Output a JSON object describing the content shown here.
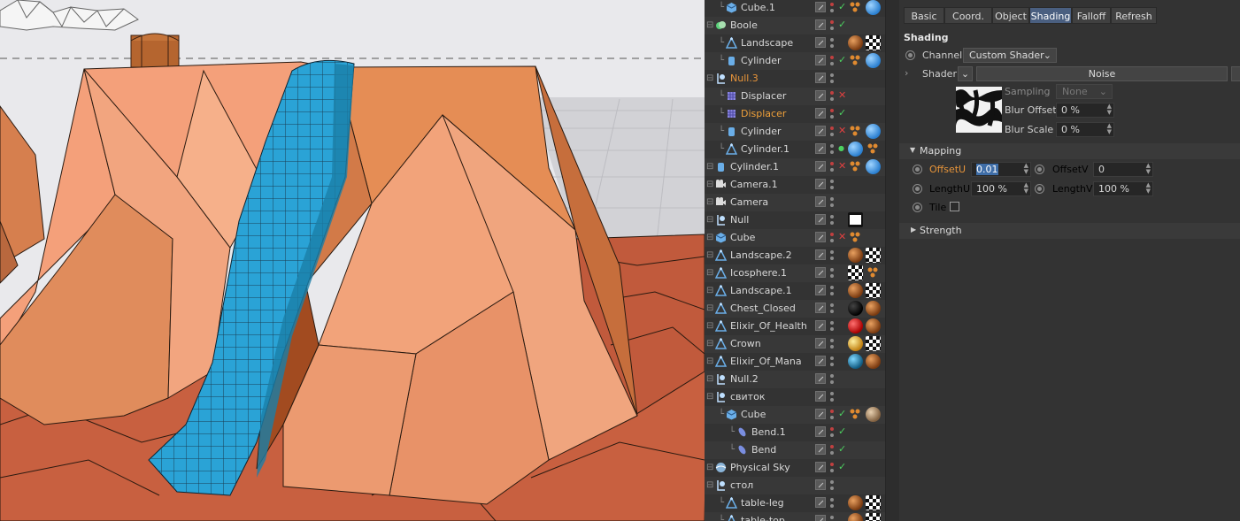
{
  "object_manager": {
    "rows": [
      {
        "name": "Cube.1",
        "icon": "cube-icon",
        "indent": 1,
        "flag": "check",
        "tags": [
          "dots-tag",
          "blue-sphere-tag"
        ],
        "color": "#d8d8d8"
      },
      {
        "name": "Boole",
        "icon": "boole-icon",
        "indent": 0,
        "flag": "check",
        "tags": [],
        "color": "#d8d8d8"
      },
      {
        "name": "Landscape",
        "icon": "landscape-icon",
        "indent": 1,
        "flag": "",
        "tags": [
          "brown-sphere-tag",
          "checker-tag"
        ],
        "color": "#d8d8d8"
      },
      {
        "name": "Cylinder",
        "icon": "cylinder-icon",
        "indent": 1,
        "flag": "check",
        "tags": [
          "dots-tag",
          "blue-sphere-tag"
        ],
        "color": "#d8d8d8"
      },
      {
        "name": "Null.3",
        "icon": "null-icon",
        "indent": 0,
        "flag": "",
        "tags": [],
        "color": "#e8953a"
      },
      {
        "name": "Displacer",
        "icon": "displacer-icon",
        "indent": 1,
        "flag": "cross",
        "tags": [],
        "color": "#d8d8d8"
      },
      {
        "name": "Displacer",
        "icon": "displacer-icon",
        "indent": 1,
        "flag": "check",
        "tags": [],
        "color": "#f0a13a"
      },
      {
        "name": "Cylinder",
        "icon": "cylinder-icon",
        "indent": 1,
        "flag": "cross",
        "tags": [
          "dots-tag",
          "blue-sphere-tag"
        ],
        "color": "#d8d8d8"
      },
      {
        "name": "Cylinder.1",
        "icon": "landscape-icon",
        "indent": 1,
        "flag": "dot",
        "tags": [
          "blue-sphere-tag",
          "dots-tag"
        ],
        "color": "#d8d8d8"
      },
      {
        "name": "Cylinder.1",
        "icon": "cylinder-icon",
        "indent": 0,
        "flag": "cross",
        "tags": [
          "dots-tag",
          "blue-sphere-tag"
        ],
        "color": "#d8d8d8"
      },
      {
        "name": "Camera.1",
        "icon": "camera-icon",
        "indent": 0,
        "flag": "",
        "tags": [],
        "color": "#d8d8d8"
      },
      {
        "name": "Camera",
        "icon": "camera-icon",
        "indent": 0,
        "flag": "",
        "tags": [],
        "color": "#d8d8d8"
      },
      {
        "name": "Null",
        "icon": "null-icon",
        "indent": 0,
        "flag": "",
        "tags": [
          "clapper-tag"
        ],
        "color": "#d8d8d8"
      },
      {
        "name": "Cube",
        "icon": "cube-icon",
        "indent": 0,
        "flag": "cross",
        "tags": [
          "dots-tag"
        ],
        "color": "#d8d8d8"
      },
      {
        "name": "Landscape.2",
        "icon": "landscape-icon",
        "indent": 0,
        "flag": "",
        "tags": [
          "brown-sphere-tag",
          "checker-tag"
        ],
        "color": "#d8d8d8"
      },
      {
        "name": "Icosphere.1",
        "icon": "landscape-icon",
        "indent": 0,
        "flag": "",
        "tags": [
          "checker-tag",
          "dots-tag"
        ],
        "color": "#d8d8d8"
      },
      {
        "name": "Landscape.1",
        "icon": "landscape-icon",
        "indent": 0,
        "flag": "",
        "tags": [
          "brown-sphere-tag",
          "checker-tag"
        ],
        "color": "#d8d8d8"
      },
      {
        "name": "Chest_Closed",
        "icon": "landscape-icon",
        "indent": 0,
        "flag": "",
        "tags": [
          "black-sphere-tag",
          "brown-sphere-tag"
        ],
        "color": "#d8d8d8"
      },
      {
        "name": "Elixir_Of_Health",
        "icon": "landscape-icon",
        "indent": 0,
        "flag": "",
        "tags": [
          "red-sphere-tag",
          "brown-sphere-tag"
        ],
        "color": "#d8d8d8"
      },
      {
        "name": "Crown",
        "icon": "landscape-icon",
        "indent": 0,
        "flag": "",
        "tags": [
          "gold-sphere-tag",
          "checker-tag"
        ],
        "color": "#d8d8d8"
      },
      {
        "name": "Elixir_Of_Mana",
        "icon": "landscape-icon",
        "indent": 0,
        "flag": "",
        "tags": [
          "teal-sphere-tag",
          "brown-sphere-tag"
        ],
        "color": "#d8d8d8"
      },
      {
        "name": "Null.2",
        "icon": "null-icon",
        "indent": 0,
        "flag": "",
        "tags": [],
        "color": "#d8d8d8"
      },
      {
        "name": "свиток",
        "icon": "null-icon",
        "indent": 0,
        "flag": "",
        "tags": [],
        "color": "#d8d8d8"
      },
      {
        "name": "Cube",
        "icon": "cube-icon",
        "indent": 1,
        "flag": "check",
        "tags": [
          "dots-tag",
          "tan-sphere-tag"
        ],
        "color": "#d8d8d8"
      },
      {
        "name": "Bend.1",
        "icon": "bend-icon",
        "indent": 2,
        "flag": "check",
        "tags": [],
        "color": "#d8d8d8"
      },
      {
        "name": "Bend",
        "icon": "bend-icon",
        "indent": 2,
        "flag": "check",
        "tags": [],
        "color": "#d8d8d8"
      },
      {
        "name": "Physical Sky",
        "icon": "sky-icon",
        "indent": 0,
        "flag": "check",
        "tags": [],
        "color": "#d8d8d8"
      },
      {
        "name": "стол",
        "icon": "null-icon",
        "indent": 0,
        "flag": "",
        "tags": [],
        "color": "#d8d8d8"
      },
      {
        "name": "table-leg",
        "icon": "landscape-icon",
        "indent": 1,
        "flag": "",
        "tags": [
          "brown-sphere-tag",
          "checker-tag"
        ],
        "color": "#d8d8d8"
      },
      {
        "name": "table-top",
        "icon": "landscape-icon",
        "indent": 1,
        "flag": "",
        "tags": [
          "brown-sphere-tag",
          "checker-tag"
        ],
        "color": "#d8d8d8"
      }
    ]
  },
  "attributes": {
    "tabs": [
      "Basic",
      "Coord.",
      "Object",
      "Shading",
      "Falloff",
      "Refresh"
    ],
    "active_tab": "Shading",
    "section_title": "Shading",
    "channel_label": "Channel",
    "channel_value": "Custom Shader",
    "shader_label": "Shader",
    "shader_name": "Noise",
    "sampling_label": "Sampling",
    "sampling_value": "None",
    "blur_offset_label": "Blur Offset",
    "blur_offset_value": "0 %",
    "blur_scale_label": "Blur Scale",
    "blur_scale_value": "0 %",
    "mapping_title": "Mapping",
    "offset_u_label": "OffsetU",
    "offset_u_value": "0.01",
    "offset_v_label": "OffsetV",
    "offset_v_value": "0",
    "length_u_label": "LengthU",
    "length_u_value": "100 %",
    "length_v_label": "LengthV",
    "length_v_value": "100 %",
    "tile_label": "Tile",
    "strength_title": "Strength"
  },
  "colors": {
    "accent_orange": "#e8953a",
    "tab_active": "#4a5f80",
    "water_blue": "#2aa3d6",
    "rock": "#e69a6a"
  }
}
